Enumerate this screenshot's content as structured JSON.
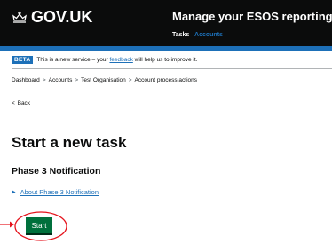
{
  "header": {
    "logo_text": "GOV.UK",
    "service_name": "Manage your ESOS reporting",
    "nav": [
      {
        "label": "Tasks"
      },
      {
        "label": "Accounts"
      }
    ]
  },
  "phase_banner": {
    "tag": "BETA",
    "text_before": "This is a new service – your",
    "link": "feedback",
    "text_after": "will help us to improve it."
  },
  "breadcrumb": {
    "items": [
      "Dashboard",
      "Accounts",
      "Test Organisation"
    ],
    "current": "Account process actions",
    "separator": ">"
  },
  "back_link": "Back",
  "page_title": "Start a new task",
  "section_heading": "Phase 3 Notification",
  "details_summary": "About Phase 3 Notification",
  "start_button": "Start",
  "colors": {
    "header_bg": "#0b0c0c",
    "accent_blue": "#1d70b8",
    "button_green": "#00703c",
    "annotation_red": "#e5131c"
  },
  "icons": {
    "logo": "crown-icon",
    "back": "chevron-left-icon",
    "details": "triangle-right-icon"
  }
}
